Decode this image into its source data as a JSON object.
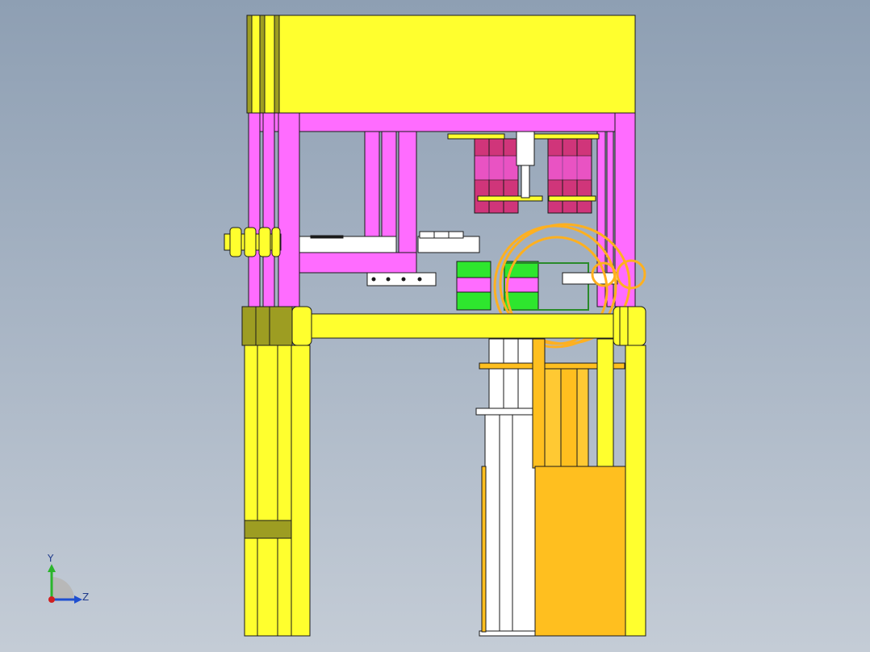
{
  "viewport": {
    "background_top": "#8e9fb3",
    "background_bottom": "#c4ccd6"
  },
  "model": {
    "colors": {
      "yellow": "#ffff2e",
      "yellow_dark": "#9a9a1a",
      "olive": "#9d9d22",
      "magenta": "#ff6cff",
      "magenta_dark": "#c048c0",
      "crimson": "#d0357a",
      "green": "#2ee62e",
      "orange": "#ffbf1f",
      "white": "#ffffff",
      "outline": "#1a1a1a"
    }
  },
  "triad": {
    "y_label": "Y",
    "z_label": "Z",
    "y_axis_color": "#2bb52b",
    "z_axis_color": "#1f4fd0",
    "x_axis_color": "#d02020",
    "disc_color": "#b8b8b8"
  }
}
